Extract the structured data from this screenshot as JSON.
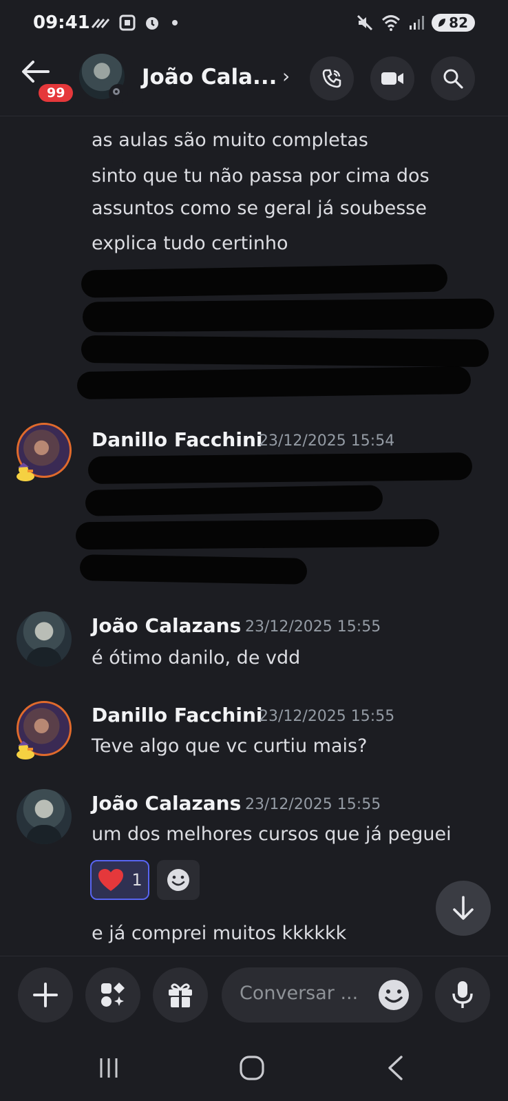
{
  "status_bar": {
    "time": "09:41",
    "battery": "82"
  },
  "header": {
    "title": "João Cala...",
    "unread_badge": "99"
  },
  "messages": {
    "continuation_lines": [
      "as aulas são muito completas",
      "sinto que tu não passa por cima dos",
      "assuntos como se geral já soubesse",
      "explica tudo certinho"
    ],
    "groups": [
      {
        "author": "Danillo Facchini",
        "timestamp": "23/12/2025 15:54"
      },
      {
        "author": "João Calazans",
        "timestamp": "23/12/2025 15:55",
        "text": "é ótimo danilo, de vdd"
      },
      {
        "author": "Danillo Facchini",
        "timestamp": "23/12/2025 15:55",
        "text": "Teve algo que vc curtiu mais?"
      },
      {
        "author": "João Calazans",
        "timestamp": "23/12/2025 15:55",
        "text": "um dos melhores cursos que já peguei",
        "reaction_count": "1",
        "followup": "e já comprei muitos kkkkkk"
      }
    ]
  },
  "composer": {
    "placeholder": "Conversar ..."
  },
  "colors": {
    "background": "#1c1d22",
    "accent": "#5865f2",
    "badge": "#e5383b",
    "heart": "#e5383b"
  }
}
